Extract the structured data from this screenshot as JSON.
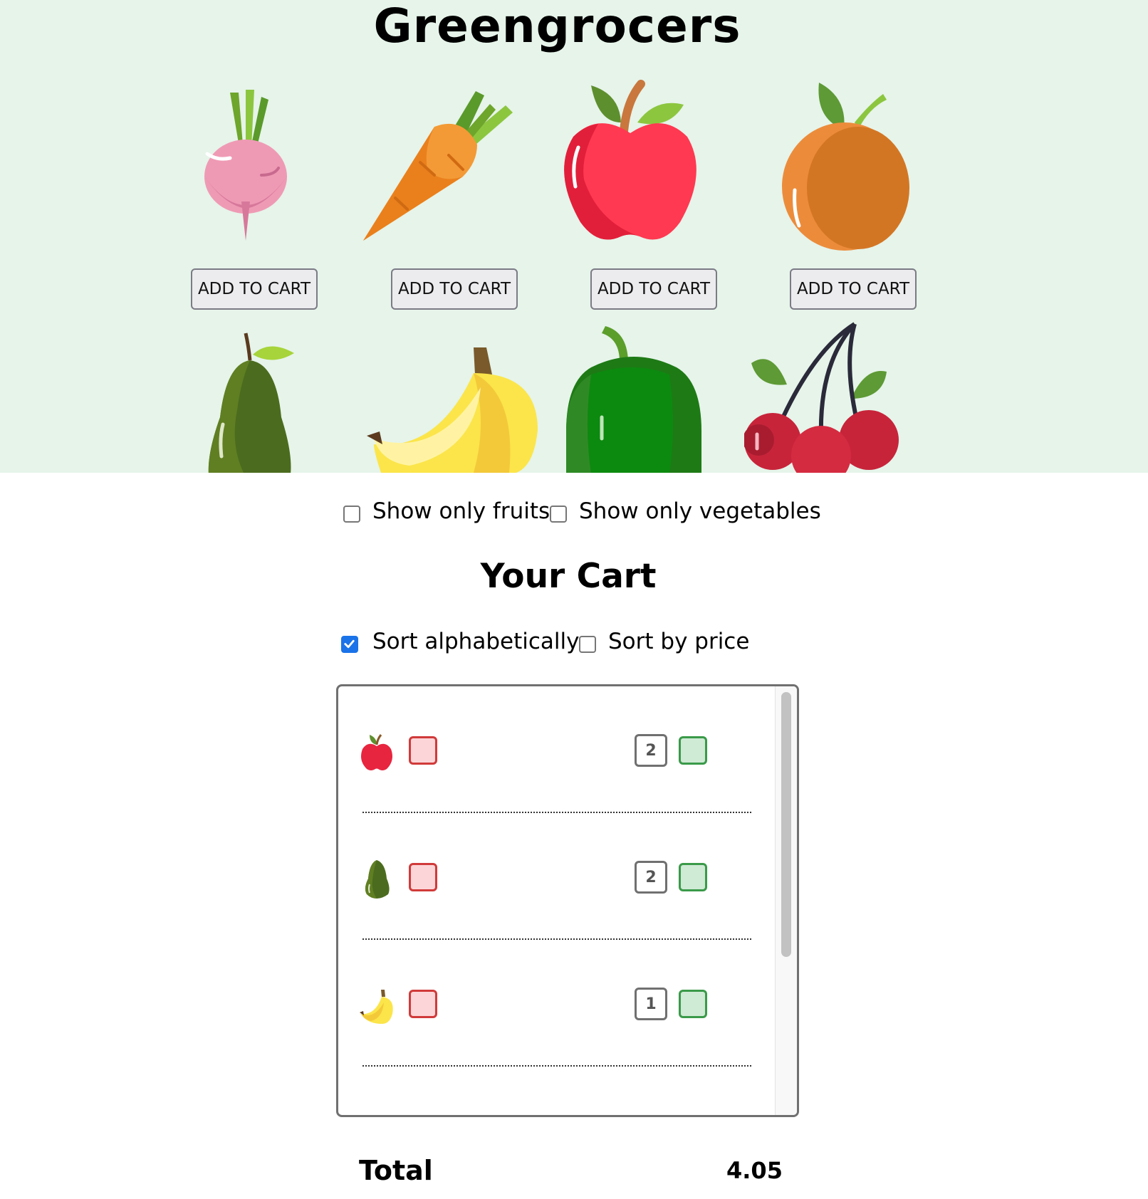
{
  "shop": {
    "title": "Greengrocers",
    "items": [
      {
        "name": "radish-icon",
        "button_label": "ADD TO CART"
      },
      {
        "name": "carrot-icon",
        "button_label": "ADD TO CART"
      },
      {
        "name": "apple-icon",
        "button_label": "ADD TO CART"
      },
      {
        "name": "apricot-icon",
        "button_label": "ADD TO CART"
      },
      {
        "name": "avocado-icon"
      },
      {
        "name": "banana-icon"
      },
      {
        "name": "pepper-icon"
      },
      {
        "name": "cherry-icon"
      }
    ]
  },
  "filters": {
    "fruits": {
      "label": "Show only fruits",
      "checked": false
    },
    "vegetables": {
      "label": "Show only vegetables",
      "checked": false
    }
  },
  "cart": {
    "title": "Your Cart",
    "sort_alpha": {
      "label": "Sort alphabetically",
      "checked": true
    },
    "sort_price": {
      "label": "Sort by price",
      "checked": false
    },
    "items": [
      {
        "icon": "apple-icon",
        "quantity": "2"
      },
      {
        "icon": "avocado-icon",
        "quantity": "2"
      },
      {
        "icon": "banana-icon",
        "quantity": "1"
      }
    ]
  },
  "total": {
    "label": "Total",
    "value": "4.05"
  },
  "colors": {
    "shop_background": "#e6f4ea",
    "remove_border": "#d13a3a",
    "remove_fill": "#fcd5d8",
    "add_border": "#3a9a49",
    "add_fill": "#cfead5",
    "checkbox_checked": "#1a73e8"
  }
}
